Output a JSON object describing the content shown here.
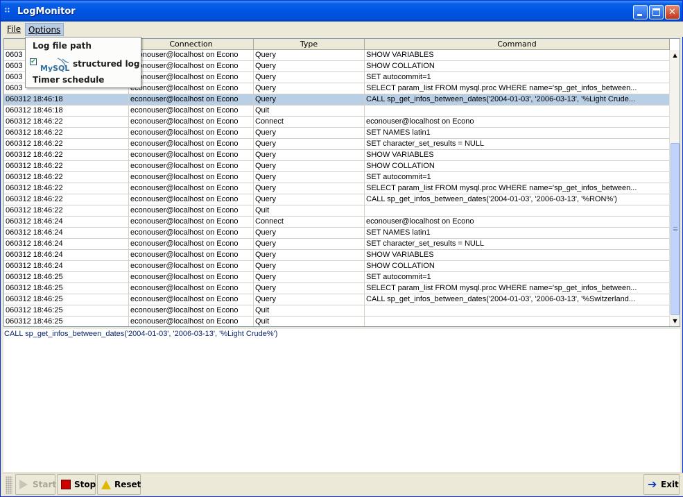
{
  "window": {
    "title": "LogMonitor",
    "icon_glyph": "∷",
    "controls": {
      "minimize": "minimize-icon",
      "maximize": "maximize-icon",
      "close_glyph": "✕"
    }
  },
  "menubar": {
    "file": "File",
    "options": "Options"
  },
  "options_menu": {
    "items": [
      {
        "label": "Log file path"
      },
      {
        "label": "structured log",
        "checked": true,
        "check_glyph": "✔",
        "logo_text": "MySQL"
      },
      {
        "label": "Timer schedule"
      }
    ]
  },
  "table": {
    "columns": [
      "",
      "Connection",
      "Type",
      "Command"
    ],
    "selected_row_index": 4,
    "rows": [
      {
        "time": "0603",
        "connection": "econouser@localhost on Econo",
        "type": "Query",
        "command": "SHOW VARIABLES"
      },
      {
        "time": "0603",
        "connection": "econouser@localhost on Econo",
        "type": "Query",
        "command": "SHOW COLLATION"
      },
      {
        "time": "0603",
        "connection": "econouser@localhost on Econo",
        "type": "Query",
        "command": "SET autocommit=1"
      },
      {
        "time": "0603",
        "connection": "econouser@localhost on Econo",
        "type": "Query",
        "command": "SELECT param_list FROM mysql.proc WHERE name='sp_get_infos_between..."
      },
      {
        "time": "060312 18:46:18",
        "connection": "econouser@localhost on Econo",
        "type": "Query",
        "command": "CALL sp_get_infos_between_dates('2004-01-03', '2006-03-13', '%Light Crude..."
      },
      {
        "time": "060312 18:46:18",
        "connection": "econouser@localhost on Econo",
        "type": "Quit",
        "command": ""
      },
      {
        "time": "060312 18:46:22",
        "connection": "econouser@localhost on Econo",
        "type": "Connect",
        "command": "econouser@localhost on Econo"
      },
      {
        "time": "060312 18:46:22",
        "connection": "econouser@localhost on Econo",
        "type": "Query",
        "command": "SET NAMES latin1"
      },
      {
        "time": "060312 18:46:22",
        "connection": "econouser@localhost on Econo",
        "type": "Query",
        "command": "SET character_set_results = NULL"
      },
      {
        "time": "060312 18:46:22",
        "connection": "econouser@localhost on Econo",
        "type": "Query",
        "command": "SHOW VARIABLES"
      },
      {
        "time": "060312 18:46:22",
        "connection": "econouser@localhost on Econo",
        "type": "Query",
        "command": "SHOW COLLATION"
      },
      {
        "time": "060312 18:46:22",
        "connection": "econouser@localhost on Econo",
        "type": "Query",
        "command": "SET autocommit=1"
      },
      {
        "time": "060312 18:46:22",
        "connection": "econouser@localhost on Econo",
        "type": "Query",
        "command": "SELECT param_list FROM mysql.proc WHERE name='sp_get_infos_between..."
      },
      {
        "time": "060312 18:46:22",
        "connection": "econouser@localhost on Econo",
        "type": "Query",
        "command": "CALL sp_get_infos_between_dates('2004-01-03', '2006-03-13', '%RON%')"
      },
      {
        "time": "060312 18:46:22",
        "connection": "econouser@localhost on Econo",
        "type": "Quit",
        "command": ""
      },
      {
        "time": "060312 18:46:24",
        "connection": "econouser@localhost on Econo",
        "type": "Connect",
        "command": "econouser@localhost on Econo"
      },
      {
        "time": "060312 18:46:24",
        "connection": "econouser@localhost on Econo",
        "type": "Query",
        "command": "SET NAMES latin1"
      },
      {
        "time": "060312 18:46:24",
        "connection": "econouser@localhost on Econo",
        "type": "Query",
        "command": "SET character_set_results = NULL"
      },
      {
        "time": "060312 18:46:24",
        "connection": "econouser@localhost on Econo",
        "type": "Query",
        "command": "SHOW VARIABLES"
      },
      {
        "time": "060312 18:46:24",
        "connection": "econouser@localhost on Econo",
        "type": "Query",
        "command": "SHOW COLLATION"
      },
      {
        "time": "060312 18:46:25",
        "connection": "econouser@localhost on Econo",
        "type": "Query",
        "command": "SET autocommit=1"
      },
      {
        "time": "060312 18:46:25",
        "connection": "econouser@localhost on Econo",
        "type": "Query",
        "command": "SELECT param_list FROM mysql.proc WHERE name='sp_get_infos_between..."
      },
      {
        "time": "060312 18:46:25",
        "connection": "econouser@localhost on Econo",
        "type": "Query",
        "command": "CALL sp_get_infos_between_dates('2004-01-03', '2006-03-13', '%Switzerland..."
      },
      {
        "time": "060312 18:46:25",
        "connection": "econouser@localhost on Econo",
        "type": "Quit",
        "command": ""
      },
      {
        "time": "060312 18:46:25",
        "connection": "econouser@localhost on Econo",
        "type": "Quit",
        "command": ""
      }
    ]
  },
  "scrollbar": {
    "up_glyph": "▲",
    "down_glyph": "▼"
  },
  "detail": {
    "text": "CALL sp_get_infos_between_dates('2004-01-03', '2006-03-13', '%Light Crude%')"
  },
  "toolbar": {
    "start_label": "Start",
    "stop_label": "Stop",
    "reset_label": "Reset",
    "exit_label": "Exit",
    "exit_glyph": "➔"
  },
  "colors": {
    "titlebar": "#0054e3",
    "selected_row": "#b8cfe5",
    "detail_text": "#0a246a"
  }
}
